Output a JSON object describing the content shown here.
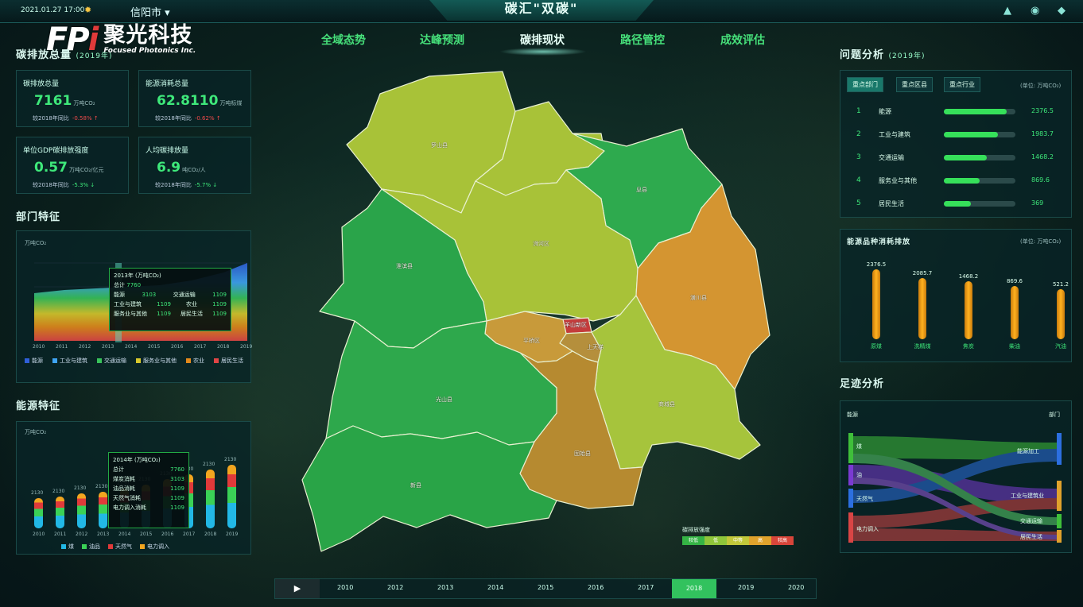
{
  "header": {
    "datetime": "2021.01.27 17:00",
    "city": "信阳市 ▾",
    "title": "碳汇\"双碳\"",
    "logo_mark": "FPi",
    "logo_cn": "聚光科技",
    "logo_en": "Focused Photonics Inc.",
    "nav": [
      "全域态势",
      "达峰预测",
      "碳排现状",
      "路径管控",
      "成效评估"
    ],
    "active_nav": "碳排现状",
    "icons": [
      "navigate-icon",
      "globe-icon",
      "cube-icon"
    ]
  },
  "left": {
    "overview_title": "碳排放总量",
    "overview_year": "(2019年)",
    "kpis": [
      {
        "label": "碳排放总量",
        "value": "7161",
        "unit": "万吨CO₂",
        "cmp_label": "较2018年同比",
        "cmp": "-0.58% ↑",
        "cmp_dir": "down"
      },
      {
        "label": "能源消耗总量",
        "value": "62.8110",
        "unit": "万吨标煤",
        "cmp_label": "较2018年同比",
        "cmp": "-0.62% ↑",
        "cmp_dir": "down"
      },
      {
        "label": "单位GDP碳排放强度",
        "value": "0.57",
        "unit": "万吨CO₂/亿元",
        "cmp_label": "较2018年同比",
        "cmp": "-5.3% ↓",
        "cmp_dir": "up"
      },
      {
        "label": "人均碳排放量",
        "value": "6.9",
        "unit": "吨CO₂/人",
        "cmp_label": "较2018年同比",
        "cmp": "-5.7% ↓",
        "cmp_dir": "up"
      }
    ],
    "sector_title": "部门特征",
    "sector_unit": "万吨CO₂",
    "sector_ticks": [
      "2010",
      "2011",
      "2012",
      "2013",
      "2014",
      "2015",
      "2016",
      "2017",
      "2018",
      "2019"
    ],
    "sector_legend": [
      {
        "name": "能源",
        "color": "#2f5fd8"
      },
      {
        "name": "工业与建筑",
        "color": "#3fa4f2"
      },
      {
        "name": "交通运输",
        "color": "#38c25a"
      },
      {
        "name": "服务业与其他",
        "color": "#d8c92c"
      },
      {
        "name": "农业",
        "color": "#e38a1a"
      },
      {
        "name": "居民生活",
        "color": "#e04545"
      }
    ],
    "sector_tip": {
      "head": "2013年 (万吨CO₂)",
      "total_label": "总计",
      "total": "7760",
      "rows": [
        [
          "能源",
          "3103",
          "交通运输",
          "1109"
        ],
        [
          "工业与建筑",
          "1109",
          "农业",
          "1109"
        ],
        [
          "服务业与其他",
          "1109",
          "居民生活",
          "1109"
        ]
      ]
    },
    "energy_title": "能源特征",
    "energy_unit": "万吨CO₂",
    "energy_ticks": [
      "2010",
      "2011",
      "2012",
      "2013",
      "2014",
      "2015",
      "2016",
      "2017",
      "2018",
      "2019"
    ],
    "energy_values": [
      "2130",
      "2130",
      "2130",
      "2130",
      "2130",
      "2130",
      "2130",
      "2130",
      "2130",
      "2130"
    ],
    "energy_legend": [
      {
        "name": "煤",
        "color": "#22b8e6"
      },
      {
        "name": "油品",
        "color": "#3ad156"
      },
      {
        "name": "天然气",
        "color": "#e03a3a"
      },
      {
        "name": "电力调入",
        "color": "#f2a51f"
      }
    ],
    "energy_tip": {
      "head": "2014年 (万吨CO₂)",
      "rows": [
        [
          "总计",
          "7760"
        ],
        [
          "煤炭消耗",
          "3103"
        ],
        [
          "油品消耗",
          "1109"
        ],
        [
          "天然气消耗",
          "1109"
        ],
        [
          "电力调入消耗",
          "1109"
        ]
      ]
    }
  },
  "map": {
    "regions": [
      {
        "name": "罗山县",
        "color": "#a8c238"
      },
      {
        "name": "光山县",
        "color": "#2aa44a"
      },
      {
        "name": "浉河区",
        "color": "#a8c238"
      },
      {
        "name": "新县",
        "color": "#29a447"
      },
      {
        "name": "商城县",
        "color": "#d49531"
      },
      {
        "name": "息县",
        "color": "#2ea84c"
      },
      {
        "name": "淮滨县",
        "color": "#2aa44a"
      },
      {
        "name": "平桥区",
        "color": "#c89a3a"
      },
      {
        "name": "羊山新区",
        "color": "#c43c3c"
      },
      {
        "name": "上天梯",
        "color": "#b58f3c"
      },
      {
        "name": "潢川县",
        "color": "#a6c43c"
      },
      {
        "name": "固始县",
        "color": "#b68a30"
      }
    ],
    "legend_title": "碳排放强度",
    "legend": [
      {
        "name": "较低",
        "color": "#35b545"
      },
      {
        "name": "低",
        "color": "#8fc63a"
      },
      {
        "name": "中等",
        "color": "#c2c83a"
      },
      {
        "name": "高",
        "color": "#e0a22c"
      },
      {
        "name": "较高",
        "color": "#d8453a"
      }
    ]
  },
  "right": {
    "problem_title": "问题分析",
    "problem_year": "(2019年)",
    "tabs": [
      "重点部门",
      "重点区县",
      "重点行业"
    ],
    "unit": "(单位: 万吨CO₂)",
    "ranks": [
      {
        "num": "1",
        "name": "能源",
        "value": "2376.5",
        "pct": 0.88
      },
      {
        "num": "2",
        "name": "工业与建筑",
        "value": "1983.7",
        "pct": 0.75
      },
      {
        "name": "交通运输",
        "num": "3",
        "value": "1468.2",
        "pct": 0.6
      },
      {
        "num": "4",
        "name": "服务业与其他",
        "value": "869.6",
        "pct": 0.5
      },
      {
        "num": "5",
        "name": "居民生活",
        "value": "369",
        "pct": 0.38
      }
    ],
    "variety_title": "能源品种消耗排放",
    "variety_unit": "(单位: 万吨CO₂)",
    "varieties": [
      {
        "name": "原煤",
        "value": "2376.5",
        "h": 0.92
      },
      {
        "name": "洗精煤",
        "value": "2085.7",
        "h": 0.8
      },
      {
        "name": "焦炭",
        "value": "1468.2",
        "h": 0.76
      },
      {
        "name": "柴油",
        "value": "869.6",
        "h": 0.7
      },
      {
        "name": "汽油",
        "value": "521.2",
        "h": 0.66
      }
    ],
    "flow_title": "足迹分析",
    "flow_left_title": "能源",
    "flow_right_title": "部门",
    "flow_left": [
      {
        "name": "煤",
        "color": "#3fbf3a"
      },
      {
        "name": "油",
        "color": "#7a3ad1"
      },
      {
        "name": "天然气",
        "color": "#2c6fe0"
      },
      {
        "name": "电力调入",
        "color": "#d84545"
      }
    ],
    "flow_right": [
      {
        "name": "能源加工",
        "color": "#2c6fe0"
      },
      {
        "name": "工业与建筑业",
        "color": "#e0a22c"
      },
      {
        "name": "交通运输",
        "color": "#3fbf3a"
      },
      {
        "name": "居民生活",
        "color": "#e0a22c"
      }
    ]
  },
  "timeline": {
    "play_label": "▶",
    "years": [
      "2010",
      "2012",
      "2013",
      "2014",
      "2015",
      "2016",
      "2017",
      "2018",
      "2019",
      "2020"
    ],
    "active": "2018"
  }
}
